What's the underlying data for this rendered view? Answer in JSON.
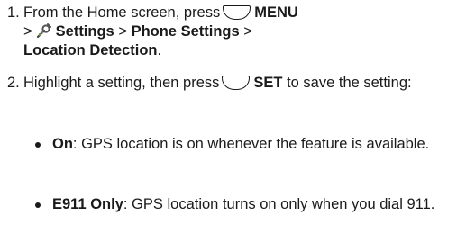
{
  "step1": {
    "number": "1.",
    "intro": "From the Home screen, press",
    "menu_key": "MENU",
    "sep1": ">",
    "settings": "Settings",
    "sep2": ">",
    "phone_settings": "Phone Settings",
    "sep3": ">",
    "location_detection": "Location Detection",
    "end": "."
  },
  "step2": {
    "number": "2.",
    "intro": "Highlight a setting, then press",
    "set_key": "SET",
    "outro": "to save the setting:"
  },
  "options": [
    {
      "term": "On",
      "desc": ": GPS location is on whenever the feature is available."
    },
    {
      "term": "E911 Only",
      "desc": ": GPS location turns on only when you dial 911."
    }
  ],
  "icons": {
    "soft_key": "soft-key-icon",
    "settings": "settings-icon"
  }
}
